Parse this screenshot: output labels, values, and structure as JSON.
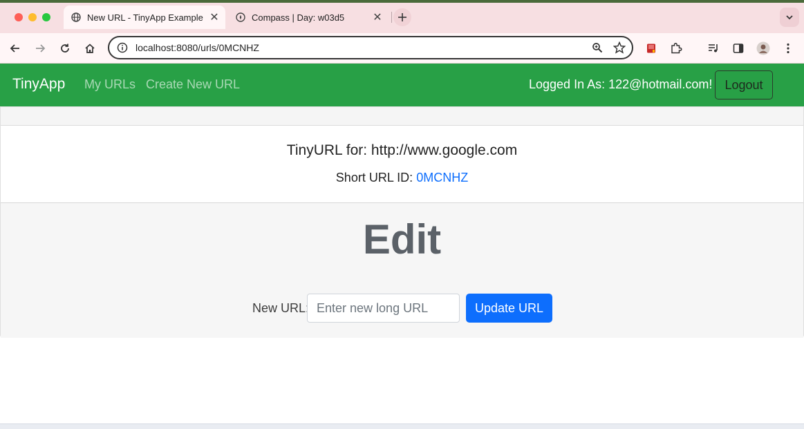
{
  "browser": {
    "tabs": [
      {
        "title": "New URL - TinyApp Example",
        "icon": "globe-icon",
        "active": true
      },
      {
        "title": "Compass | Day: w03d5",
        "icon": "compass-icon",
        "active": false
      }
    ],
    "address": "localhost:8080/urls/0MCNHZ",
    "accent_color": "#f7dfe2"
  },
  "navbar": {
    "brand": "TinyApp",
    "links": [
      "My URLs",
      "Create New URL"
    ],
    "logged_in_text": "Logged In As: 122@hotmail.com!",
    "logout_label": "Logout",
    "color": "#28a046"
  },
  "card": {
    "title": "TinyURL for: http://www.google.com",
    "short_id_label": "Short URL ID:",
    "short_id": "0MCNHZ"
  },
  "edit": {
    "heading": "Edit",
    "label": "New URL:",
    "placeholder": "Enter new long URL",
    "button": "Update URL",
    "button_color": "#0d6efd"
  }
}
